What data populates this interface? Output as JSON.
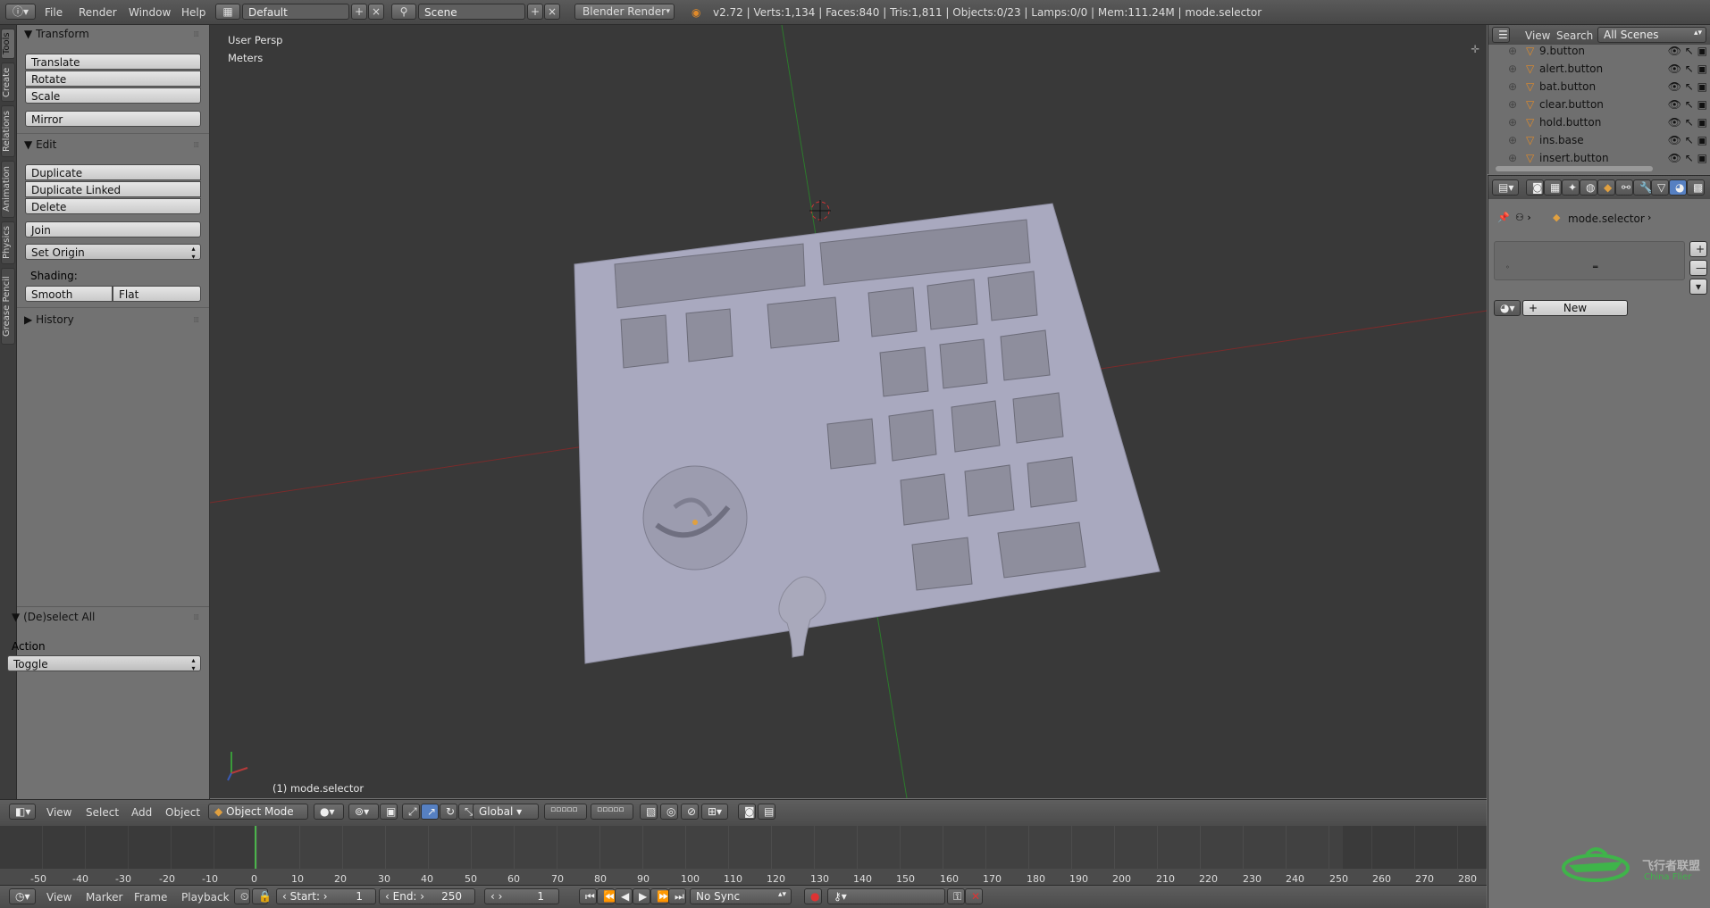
{
  "topbar": {
    "menus": [
      "File",
      "Render",
      "Window",
      "Help"
    ],
    "layout": "Default",
    "scene": "Scene",
    "engine": "Blender Render",
    "stats": "v2.72 | Verts:1,134 | Faces:840 | Tris:1,811 | Objects:0/23 | Lamps:0/0 | Mem:111.24M | mode.selector"
  },
  "left_tabs": [
    "Tools",
    "Create",
    "Relations",
    "Animation",
    "Physics",
    "Grease Pencil"
  ],
  "toolshelf": {
    "transform_header": "Transform",
    "translate": "Translate",
    "rotate": "Rotate",
    "scale": "Scale",
    "mirror": "Mirror",
    "edit_header": "Edit",
    "duplicate": "Duplicate",
    "duplicate_linked": "Duplicate Linked",
    "delete": "Delete",
    "join": "Join",
    "set_origin": "Set Origin",
    "shading_label": "Shading:",
    "smooth": "Smooth",
    "flat": "Flat",
    "history_header": "History",
    "operator_header": "(De)select All",
    "action_label": "Action",
    "action_value": "Toggle"
  },
  "viewport": {
    "view_name": "User Persp",
    "units": "Meters",
    "active_object": "(1) mode.selector"
  },
  "view3d_header": {
    "menus": [
      "View",
      "Select",
      "Add",
      "Object"
    ],
    "mode": "Object Mode",
    "orientation": "Global"
  },
  "timeline": {
    "ticks": [
      "-50",
      "-40",
      "-30",
      "-20",
      "-10",
      "0",
      "10",
      "20",
      "30",
      "40",
      "50",
      "60",
      "70",
      "80",
      "90",
      "100",
      "110",
      "120",
      "130",
      "140",
      "150",
      "160",
      "170",
      "180",
      "190",
      "200",
      "210",
      "220",
      "230",
      "240",
      "250",
      "260",
      "270",
      "280"
    ],
    "current_frame_marker": 0,
    "menus": [
      "View",
      "Marker",
      "Frame",
      "Playback"
    ],
    "start_label": "Start:",
    "start_value": "1",
    "end_label": "End:",
    "end_value": "250",
    "current_frame": "1",
    "sync": "No Sync"
  },
  "outliner": {
    "view": "View",
    "search": "Search",
    "filter": "All Scenes",
    "items": [
      "9.button",
      "alert.button",
      "bat.button",
      "clear.button",
      "hold.button",
      "ins.base",
      "insert.button"
    ]
  },
  "properties": {
    "breadcrumb_object": "mode.selector",
    "new_button": "New"
  },
  "watermark": {
    "text_cn": "飞行者联盟",
    "text_en": "China Flier"
  }
}
